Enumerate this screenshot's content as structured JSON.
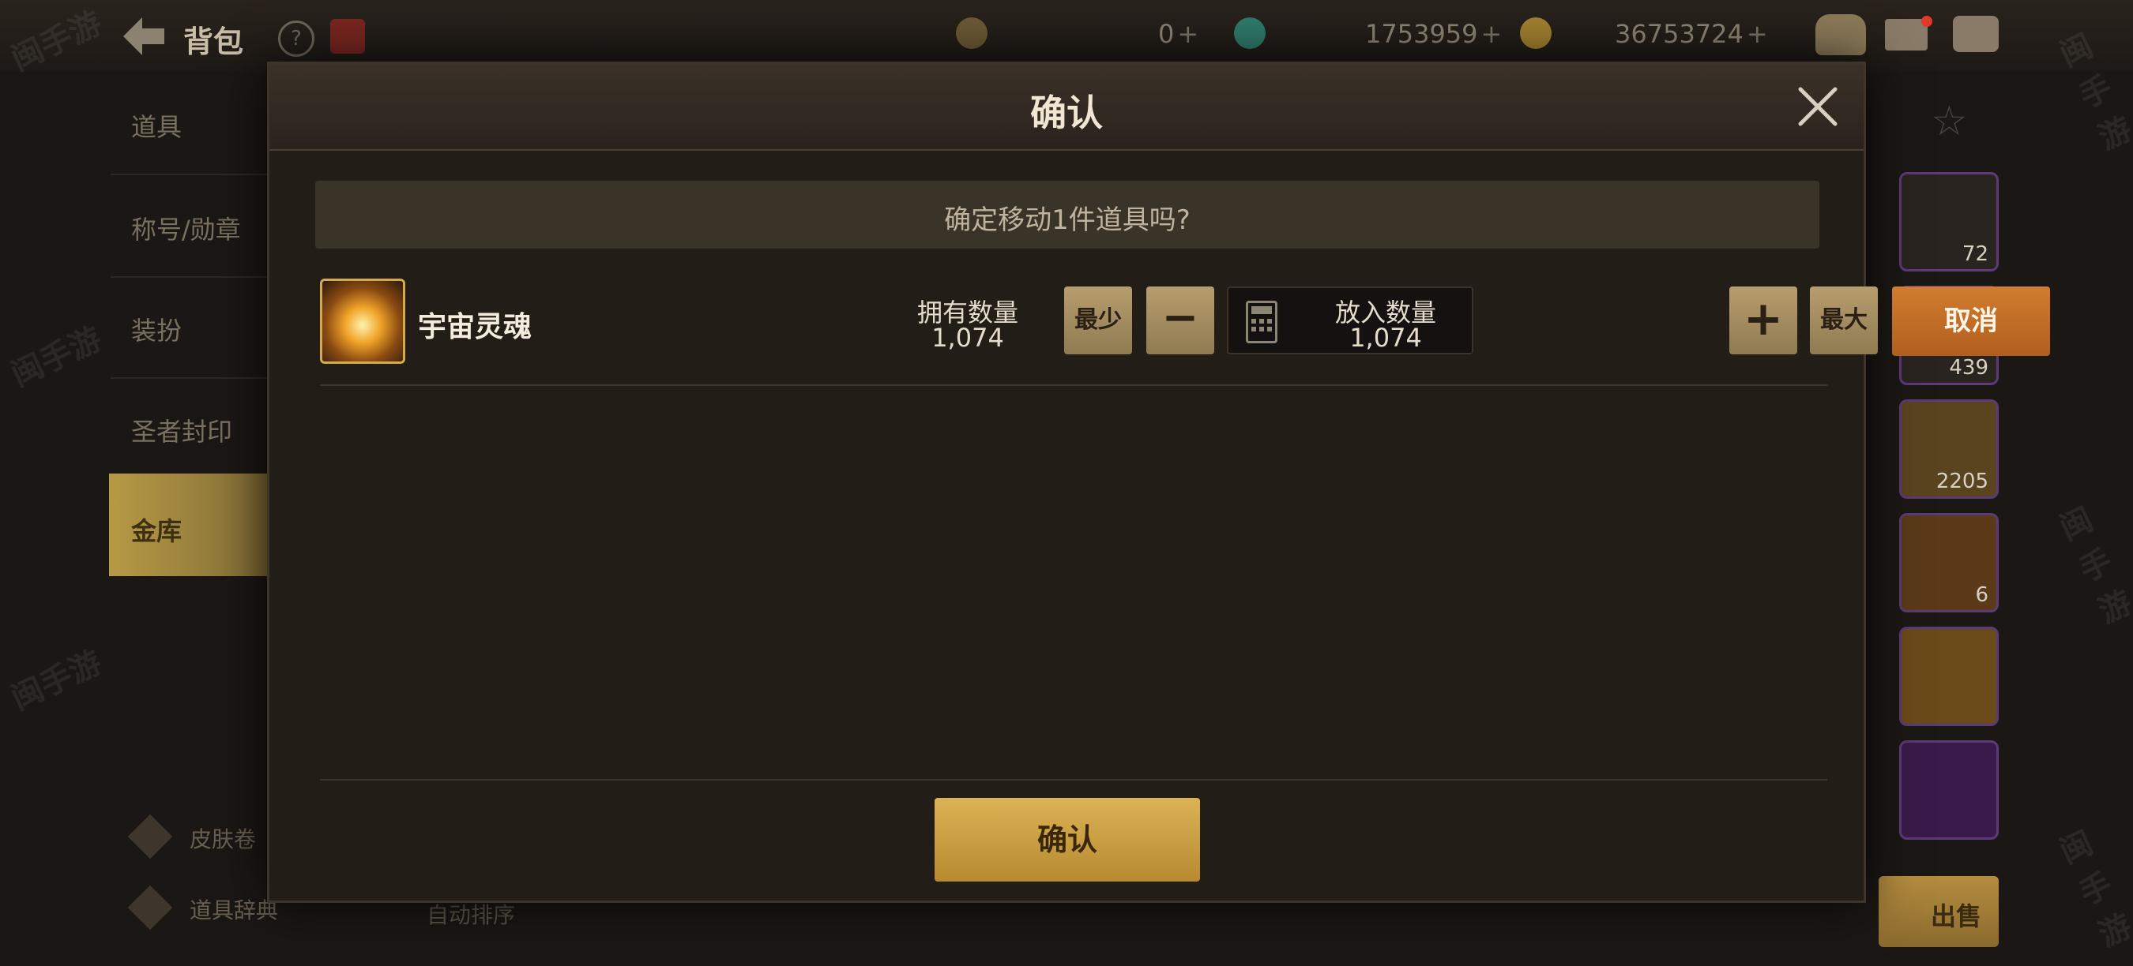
{
  "topbar": {
    "title": "背包",
    "currency_a": "0",
    "currency_b": "1753959",
    "currency_c": "36753724",
    "plus": "+"
  },
  "sidebar": {
    "items": [
      "道具",
      "称号/勋章",
      "装扮",
      "圣者封印",
      "金库"
    ],
    "active_index": 4,
    "bottom_items": [
      "皮肤卷",
      "道具辞典"
    ],
    "sort_label": "自动排序"
  },
  "right_column": {
    "slot_counts": [
      "72",
      "439",
      "2205",
      "6",
      "",
      ""
    ],
    "sell_label": "出售"
  },
  "dialog": {
    "title": "确认",
    "prompt": "确定移动1件道具吗?",
    "item": {
      "name": "宇宙灵魂",
      "owned_label": "拥有数量",
      "owned_value": "1,074"
    },
    "quantity": {
      "min_label": "最少",
      "minus_label": "−",
      "put_label": "放入数量",
      "put_value": "1,074",
      "plus_label": "+",
      "max_label": "最大"
    },
    "cancel_label": "取消",
    "confirm_label": "确认"
  },
  "watermark": "闽手游",
  "colors": {
    "accent_gold": "#d6a94a",
    "cancel_orange": "#c46d26",
    "confirm_gold": "#c99b3e",
    "dialog_bg": "#231d18"
  }
}
